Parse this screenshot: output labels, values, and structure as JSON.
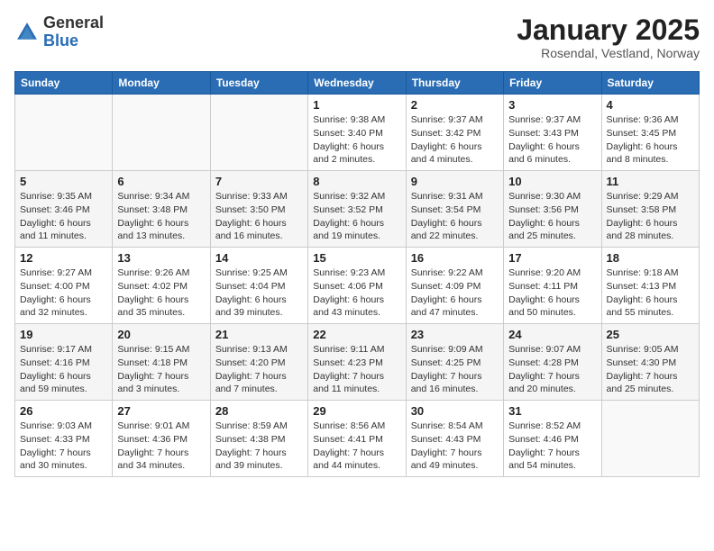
{
  "header": {
    "logo": {
      "general": "General",
      "blue": "Blue"
    },
    "title": "January 2025",
    "subtitle": "Rosendal, Vestland, Norway"
  },
  "weekdays": [
    "Sunday",
    "Monday",
    "Tuesday",
    "Wednesday",
    "Thursday",
    "Friday",
    "Saturday"
  ],
  "weeks": [
    [
      {
        "day": "",
        "sunrise": "",
        "sunset": "",
        "daylight": ""
      },
      {
        "day": "",
        "sunrise": "",
        "sunset": "",
        "daylight": ""
      },
      {
        "day": "",
        "sunrise": "",
        "sunset": "",
        "daylight": ""
      },
      {
        "day": "1",
        "sunrise": "Sunrise: 9:38 AM",
        "sunset": "Sunset: 3:40 PM",
        "daylight": "Daylight: 6 hours and 2 minutes."
      },
      {
        "day": "2",
        "sunrise": "Sunrise: 9:37 AM",
        "sunset": "Sunset: 3:42 PM",
        "daylight": "Daylight: 6 hours and 4 minutes."
      },
      {
        "day": "3",
        "sunrise": "Sunrise: 9:37 AM",
        "sunset": "Sunset: 3:43 PM",
        "daylight": "Daylight: 6 hours and 6 minutes."
      },
      {
        "day": "4",
        "sunrise": "Sunrise: 9:36 AM",
        "sunset": "Sunset: 3:45 PM",
        "daylight": "Daylight: 6 hours and 8 minutes."
      }
    ],
    [
      {
        "day": "5",
        "sunrise": "Sunrise: 9:35 AM",
        "sunset": "Sunset: 3:46 PM",
        "daylight": "Daylight: 6 hours and 11 minutes."
      },
      {
        "day": "6",
        "sunrise": "Sunrise: 9:34 AM",
        "sunset": "Sunset: 3:48 PM",
        "daylight": "Daylight: 6 hours and 13 minutes."
      },
      {
        "day": "7",
        "sunrise": "Sunrise: 9:33 AM",
        "sunset": "Sunset: 3:50 PM",
        "daylight": "Daylight: 6 hours and 16 minutes."
      },
      {
        "day": "8",
        "sunrise": "Sunrise: 9:32 AM",
        "sunset": "Sunset: 3:52 PM",
        "daylight": "Daylight: 6 hours and 19 minutes."
      },
      {
        "day": "9",
        "sunrise": "Sunrise: 9:31 AM",
        "sunset": "Sunset: 3:54 PM",
        "daylight": "Daylight: 6 hours and 22 minutes."
      },
      {
        "day": "10",
        "sunrise": "Sunrise: 9:30 AM",
        "sunset": "Sunset: 3:56 PM",
        "daylight": "Daylight: 6 hours and 25 minutes."
      },
      {
        "day": "11",
        "sunrise": "Sunrise: 9:29 AM",
        "sunset": "Sunset: 3:58 PM",
        "daylight": "Daylight: 6 hours and 28 minutes."
      }
    ],
    [
      {
        "day": "12",
        "sunrise": "Sunrise: 9:27 AM",
        "sunset": "Sunset: 4:00 PM",
        "daylight": "Daylight: 6 hours and 32 minutes."
      },
      {
        "day": "13",
        "sunrise": "Sunrise: 9:26 AM",
        "sunset": "Sunset: 4:02 PM",
        "daylight": "Daylight: 6 hours and 35 minutes."
      },
      {
        "day": "14",
        "sunrise": "Sunrise: 9:25 AM",
        "sunset": "Sunset: 4:04 PM",
        "daylight": "Daylight: 6 hours and 39 minutes."
      },
      {
        "day": "15",
        "sunrise": "Sunrise: 9:23 AM",
        "sunset": "Sunset: 4:06 PM",
        "daylight": "Daylight: 6 hours and 43 minutes."
      },
      {
        "day": "16",
        "sunrise": "Sunrise: 9:22 AM",
        "sunset": "Sunset: 4:09 PM",
        "daylight": "Daylight: 6 hours and 47 minutes."
      },
      {
        "day": "17",
        "sunrise": "Sunrise: 9:20 AM",
        "sunset": "Sunset: 4:11 PM",
        "daylight": "Daylight: 6 hours and 50 minutes."
      },
      {
        "day": "18",
        "sunrise": "Sunrise: 9:18 AM",
        "sunset": "Sunset: 4:13 PM",
        "daylight": "Daylight: 6 hours and 55 minutes."
      }
    ],
    [
      {
        "day": "19",
        "sunrise": "Sunrise: 9:17 AM",
        "sunset": "Sunset: 4:16 PM",
        "daylight": "Daylight: 6 hours and 59 minutes."
      },
      {
        "day": "20",
        "sunrise": "Sunrise: 9:15 AM",
        "sunset": "Sunset: 4:18 PM",
        "daylight": "Daylight: 7 hours and 3 minutes."
      },
      {
        "day": "21",
        "sunrise": "Sunrise: 9:13 AM",
        "sunset": "Sunset: 4:20 PM",
        "daylight": "Daylight: 7 hours and 7 minutes."
      },
      {
        "day": "22",
        "sunrise": "Sunrise: 9:11 AM",
        "sunset": "Sunset: 4:23 PM",
        "daylight": "Daylight: 7 hours and 11 minutes."
      },
      {
        "day": "23",
        "sunrise": "Sunrise: 9:09 AM",
        "sunset": "Sunset: 4:25 PM",
        "daylight": "Daylight: 7 hours and 16 minutes."
      },
      {
        "day": "24",
        "sunrise": "Sunrise: 9:07 AM",
        "sunset": "Sunset: 4:28 PM",
        "daylight": "Daylight: 7 hours and 20 minutes."
      },
      {
        "day": "25",
        "sunrise": "Sunrise: 9:05 AM",
        "sunset": "Sunset: 4:30 PM",
        "daylight": "Daylight: 7 hours and 25 minutes."
      }
    ],
    [
      {
        "day": "26",
        "sunrise": "Sunrise: 9:03 AM",
        "sunset": "Sunset: 4:33 PM",
        "daylight": "Daylight: 7 hours and 30 minutes."
      },
      {
        "day": "27",
        "sunrise": "Sunrise: 9:01 AM",
        "sunset": "Sunset: 4:36 PM",
        "daylight": "Daylight: 7 hours and 34 minutes."
      },
      {
        "day": "28",
        "sunrise": "Sunrise: 8:59 AM",
        "sunset": "Sunset: 4:38 PM",
        "daylight": "Daylight: 7 hours and 39 minutes."
      },
      {
        "day": "29",
        "sunrise": "Sunrise: 8:56 AM",
        "sunset": "Sunset: 4:41 PM",
        "daylight": "Daylight: 7 hours and 44 minutes."
      },
      {
        "day": "30",
        "sunrise": "Sunrise: 8:54 AM",
        "sunset": "Sunset: 4:43 PM",
        "daylight": "Daylight: 7 hours and 49 minutes."
      },
      {
        "day": "31",
        "sunrise": "Sunrise: 8:52 AM",
        "sunset": "Sunset: 4:46 PM",
        "daylight": "Daylight: 7 hours and 54 minutes."
      },
      {
        "day": "",
        "sunrise": "",
        "sunset": "",
        "daylight": ""
      }
    ]
  ]
}
